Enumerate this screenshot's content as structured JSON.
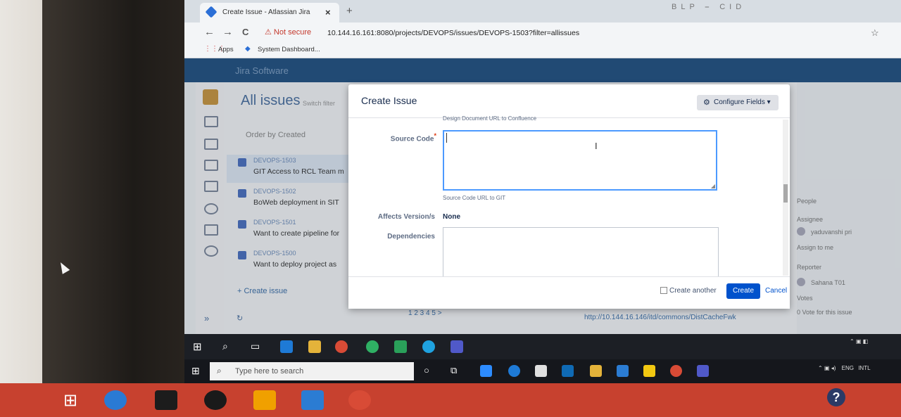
{
  "browser": {
    "tab_title": "Create Issue - Atlassian Jira",
    "tab_close": "×",
    "new_tab": "+",
    "window_controls": "BLP   ⎯   CID",
    "nav_back": "←",
    "nav_forward": "→",
    "nav_reload": "C",
    "security_warning": "Not secure",
    "url": "10.144.16.161:8080/projects/DEVOPS/issues/DEVOPS-1503?filter=allissues",
    "star": "☆",
    "bookmarks": {
      "apps": "Apps",
      "system_dashboard": "System Dashboard..."
    }
  },
  "jira": {
    "brand": "Jira Software",
    "page_title": "All issues",
    "switch_filter": "Switch filter",
    "order_by": "Order by Created",
    "issues": [
      {
        "key": "DEVOPS-1503",
        "summary": "GIT Access to RCL Team m"
      },
      {
        "key": "DEVOPS-1502",
        "summary": "BoWeb deployment in SIT"
      },
      {
        "key": "DEVOPS-1501",
        "summary": "Want to create pipeline for"
      },
      {
        "key": "DEVOPS-1500",
        "summary": "Want to deploy project as"
      }
    ],
    "create_issue_link": "+ Create issue",
    "pagination": "1 2 3 4 5 >",
    "bottom_url": "http://10.144.16.146/itd/commons/DistCacheFwk",
    "right_panel": {
      "people": "People",
      "assignee": "Assignee",
      "assignee_name": "yaduvanshi pri",
      "assign_to_me": "Assign to me",
      "reporter": "Reporter",
      "reporter_name": "Sahana T01",
      "votes": "Votes",
      "vote_text": "0  Vote for this issue"
    }
  },
  "dialog": {
    "title": "Create Issue",
    "configure_fields": "Configure Fields ▾",
    "design_doc_help": "Design Document URL to Confluence",
    "source_code_label": "Source Code",
    "required_mark": "*",
    "source_code_value": "",
    "source_code_help": "Source Code URL to GIT",
    "affects_version_label": "Affects Version/s",
    "affects_version_value": "None",
    "dependencies_label": "Dependencies",
    "create_another": "Create another",
    "create_button": "Create",
    "cancel_link": "Cancel"
  },
  "taskbar": {
    "search_placeholder": "Type here to search",
    "tray_lang": "ENG",
    "tray_lang2": "INTL"
  },
  "colors": {
    "jira_blue": "#0052cc",
    "header_blue": "#205081",
    "focus_border": "#4c9aff",
    "required_red": "#de350b",
    "outer_taskbar": "#c7412f"
  }
}
